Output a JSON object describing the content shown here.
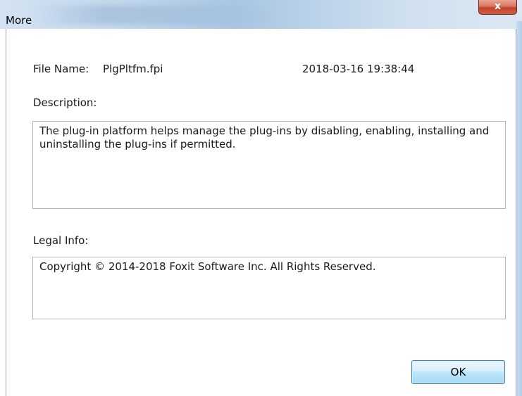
{
  "window": {
    "title": "More",
    "close_glyph": "x",
    "close_icon": "close-icon"
  },
  "file": {
    "name_label": "File Name:",
    "name_value": "PlgPltfm.fpi",
    "date_value": "2018-03-16 19:38:44"
  },
  "description": {
    "label": "Description:",
    "text": "The plug-in platform helps manage the plug-ins by disabling, enabling, installing and uninstalling the plug-ins if permitted."
  },
  "legal": {
    "label": "Legal Info:",
    "text": "Copyright © 2014-2018 Foxit Software Inc. All Rights Reserved."
  },
  "buttons": {
    "ok_label": "OK"
  },
  "colors": {
    "close_button": "#c7462c",
    "ok_border": "#3c7fb1",
    "titlebar": "#bcd3ea"
  }
}
